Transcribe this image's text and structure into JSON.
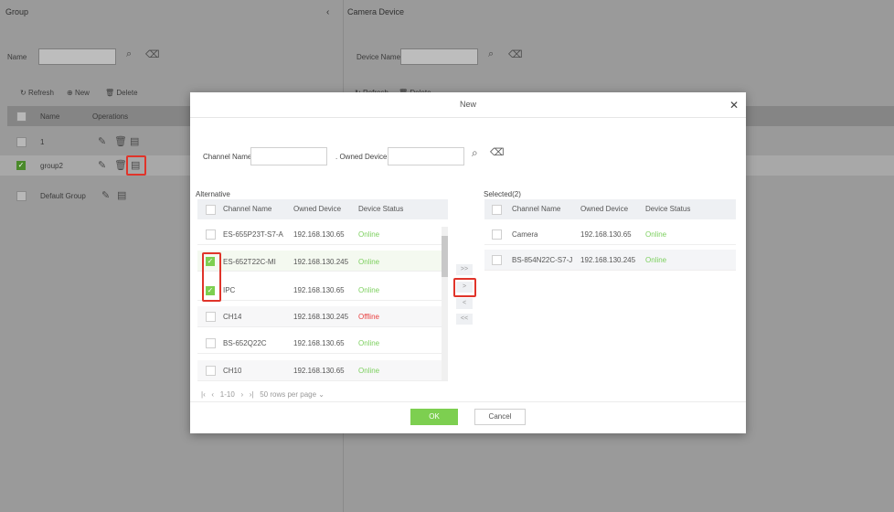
{
  "left_panel": {
    "title": "Group",
    "collapse_icon": "chevron-left-icon",
    "search_label": "Name",
    "toolbar": {
      "refresh": "Refresh",
      "new": "New",
      "delete": "Delete"
    },
    "columns": {
      "name": "Name",
      "operations": "Operations"
    },
    "rows": [
      {
        "name": "1"
      },
      {
        "name": "group2"
      },
      {
        "name": "Default Group"
      }
    ]
  },
  "right_panel": {
    "title": "Camera Device",
    "search_label": "Device Name",
    "toolbar": {
      "refresh": "Refresh",
      "delete": "Delete"
    }
  },
  "modal": {
    "title": "New",
    "channel_name_label": "Channel Name",
    "owned_device_label": "Owned Device",
    "alternative_label": "Alternative",
    "selected_label": "Selected(2)",
    "columns": {
      "channel_name": "Channel Name",
      "owned_device": "Owned Device",
      "device_status": "Device Status"
    },
    "alternative_rows": [
      {
        "channel": "ES-655P23T-S7-A",
        "device": "192.168.130.65",
        "status": "Online",
        "checked": false
      },
      {
        "channel": "ES-652T22C-MI",
        "device": "192.168.130.245",
        "status": "Online",
        "checked": true
      },
      {
        "channel": "IPC",
        "device": "192.168.130.65",
        "status": "Online",
        "checked": true
      },
      {
        "channel": "CH14",
        "device": "192.168.130.245",
        "status": "Offline",
        "checked": false
      },
      {
        "channel": "BS-652Q22C",
        "device": "192.168.130.65",
        "status": "Online",
        "checked": false
      },
      {
        "channel": "CH10",
        "device": "192.168.130.65",
        "status": "Online",
        "checked": false
      }
    ],
    "selected_rows": [
      {
        "channel": "Camera",
        "device": "192.168.130.65",
        "status": "Online"
      },
      {
        "channel": "BS-854N22C-S7-J",
        "device": "192.168.130.245",
        "status": "Online"
      }
    ],
    "pagination": {
      "range": "1-10",
      "per_page": "50 rows per page"
    },
    "move_buttons": {
      "all_right": ">>",
      "right": ">",
      "left": "<",
      "all_left": "<<"
    },
    "ok": "OK",
    "cancel": "Cancel"
  },
  "colors": {
    "accent": "#7dcf50",
    "offline": "#e94141",
    "highlight": "#e0342a"
  }
}
